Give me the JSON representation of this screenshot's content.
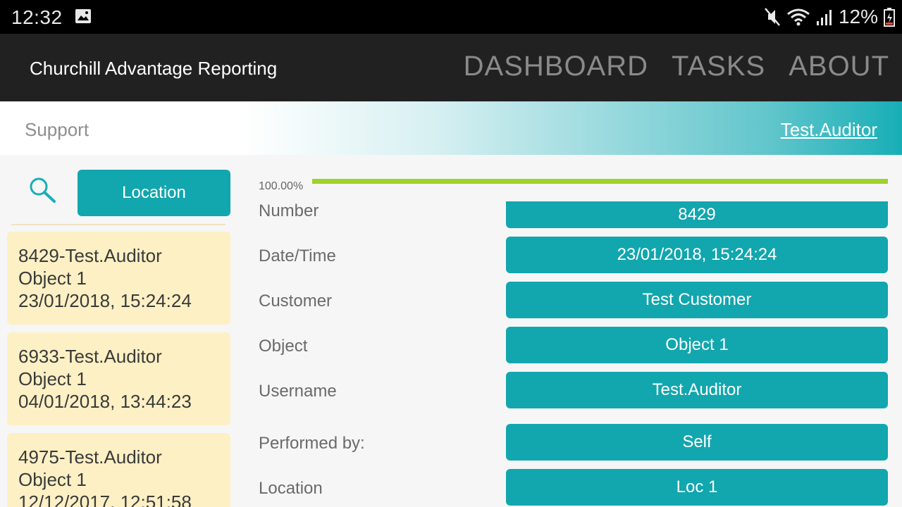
{
  "status_bar": {
    "time": "12:32",
    "battery": "12%",
    "icons": [
      "photo-icon",
      "mute-icon",
      "wifi-icon",
      "signal-icon",
      "battery-icon"
    ]
  },
  "app_bar": {
    "title": "Churchill Advantage Reporting",
    "nav": [
      "DASHBOARD",
      "TASKS",
      "ABOUT"
    ]
  },
  "sub_header": {
    "left": "Support",
    "user": "Test.Auditor"
  },
  "left_panel": {
    "location_button": "Location",
    "records": [
      {
        "line1": "8429-Test.Auditor",
        "line2": "Object 1",
        "line3": "23/01/2018, 15:24:24"
      },
      {
        "line1": "6933-Test.Auditor",
        "line2": "Object 1",
        "line3": "04/01/2018, 13:44:23"
      },
      {
        "line1": "4975-Test.Auditor",
        "line2": "Object 1",
        "line3": "12/12/2017, 12:51:58"
      }
    ]
  },
  "details": {
    "progress_label": "100.00%",
    "progress_value": 1.0,
    "fields": [
      {
        "label": "Number",
        "value": "8429"
      },
      {
        "label": "Date/Time",
        "value": "23/01/2018, 15:24:24"
      },
      {
        "label": "Customer",
        "value": "Test Customer"
      },
      {
        "label": "Object",
        "value": "Object 1"
      },
      {
        "label": "Username",
        "value": "Test.Auditor"
      },
      {
        "label": "Performed by:",
        "value": "Self"
      },
      {
        "label": "Location",
        "value": "Loc 1"
      }
    ]
  },
  "colors": {
    "accent": "#12a6ae",
    "card": "#fdf0c4",
    "progress": "#9fd22a",
    "appbar": "#212121"
  }
}
